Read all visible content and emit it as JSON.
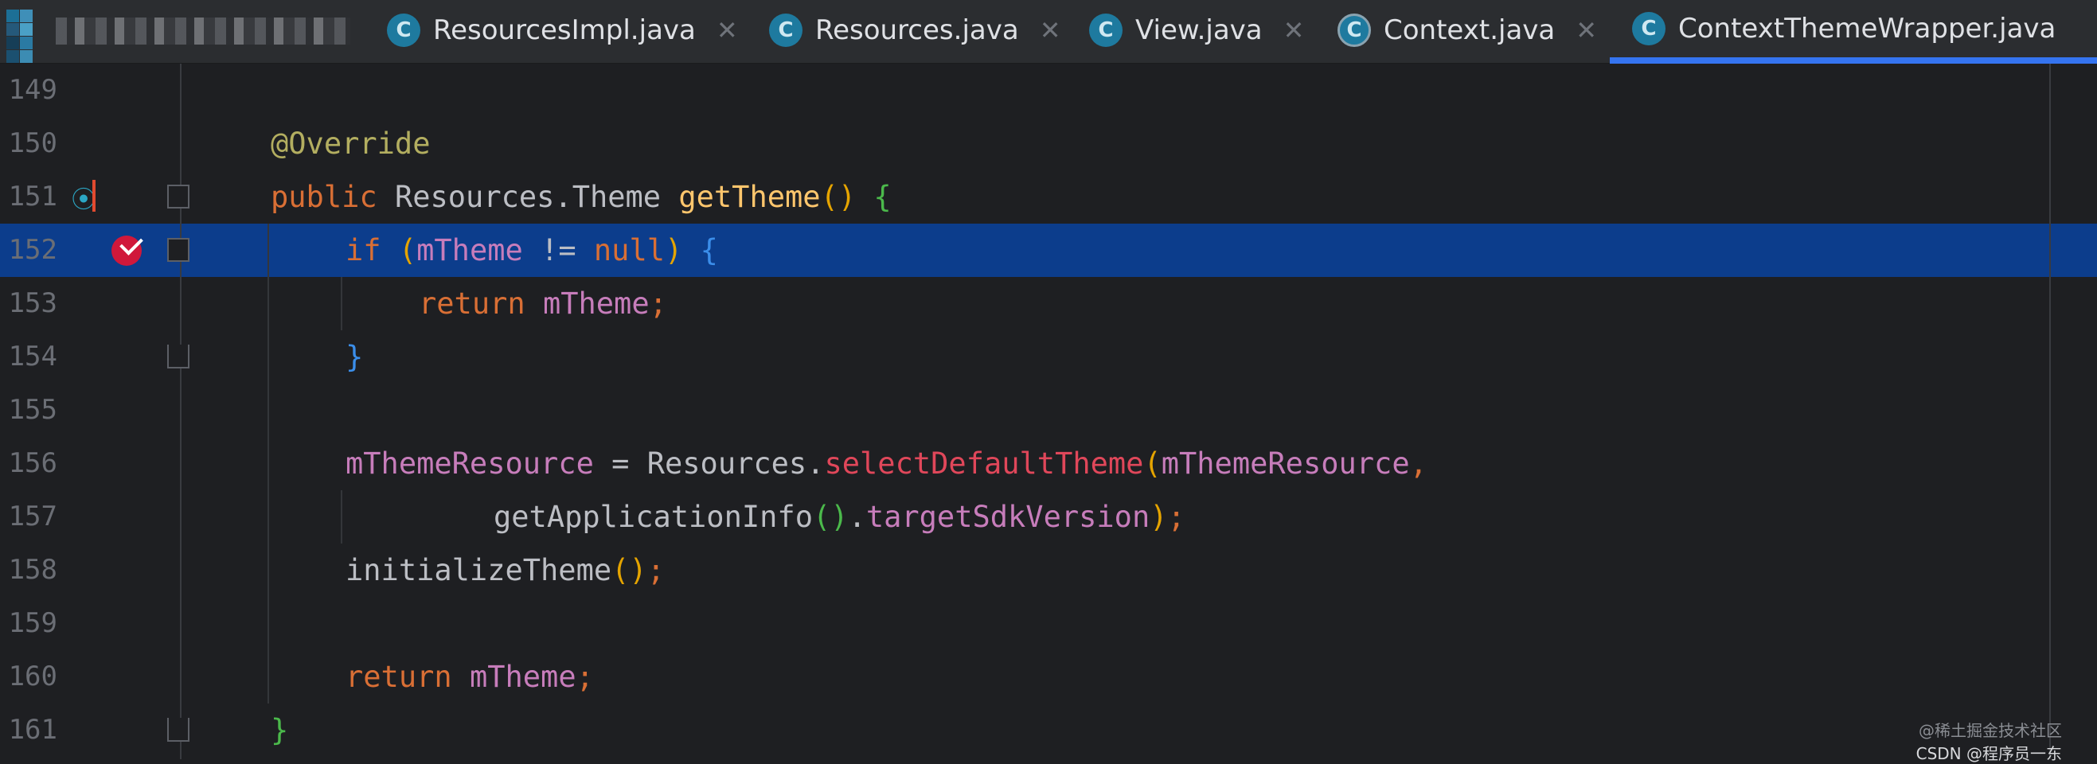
{
  "tabs": [
    {
      "label": "ResourcesImpl.java",
      "icon": "class-icon",
      "active": false
    },
    {
      "label": "Resources.java",
      "icon": "class-icon",
      "active": false
    },
    {
      "label": "View.java",
      "icon": "class-icon",
      "active": false
    },
    {
      "label": "Context.java",
      "icon": "abstract-class-icon",
      "active": false
    },
    {
      "label": "ContextThemeWrapper.java",
      "icon": "class-icon",
      "active": true
    }
  ],
  "tab_icon_letter": "C",
  "close_glyph": "✕",
  "gutter": {
    "line_numbers": [
      "149",
      "150",
      "151",
      "152",
      "153",
      "154",
      "155",
      "156",
      "157",
      "158",
      "159",
      "160",
      "161"
    ],
    "breakpoint_line": "152",
    "override_line": "151"
  },
  "code": {
    "l150": {
      "annotation": "@Override"
    },
    "l151": {
      "kw": "public",
      "type": "Resources.Theme",
      "method": "getTheme",
      "parens": "()",
      "brace": "{"
    },
    "l152": {
      "kw": "if",
      "open": "(",
      "field": "mTheme",
      "op": "!=",
      "null": "null",
      "close": ")",
      "brace": "{"
    },
    "l153": {
      "kw": "return",
      "field": "mTheme",
      "semi": ";"
    },
    "l154": {
      "brace": "}"
    },
    "l156": {
      "field": "mThemeResource",
      "eq": "=",
      "cls": "Resources.",
      "method": "selectDefaultTheme",
      "open": "(",
      "arg": "mThemeResource",
      "comma": ","
    },
    "l157": {
      "call": "getApplicationInfo",
      "parens": "()",
      "dot": ".",
      "field": "targetSdkVersion",
      "close": ")",
      "semi": ";"
    },
    "l158": {
      "call": "initializeTheme",
      "parens": "()",
      "semi": ";"
    },
    "l160": {
      "kw": "return",
      "field": "mTheme",
      "semi": ";"
    },
    "l161": {
      "brace": "}"
    }
  },
  "watermark": {
    "line1": "@稀土掘金技术社区",
    "line2": "CSDN @程序员一东"
  },
  "colors": {
    "selection": "#0c3d8c",
    "active_tab_underline": "#3574f0",
    "breakpoint": "#d0183b"
  }
}
